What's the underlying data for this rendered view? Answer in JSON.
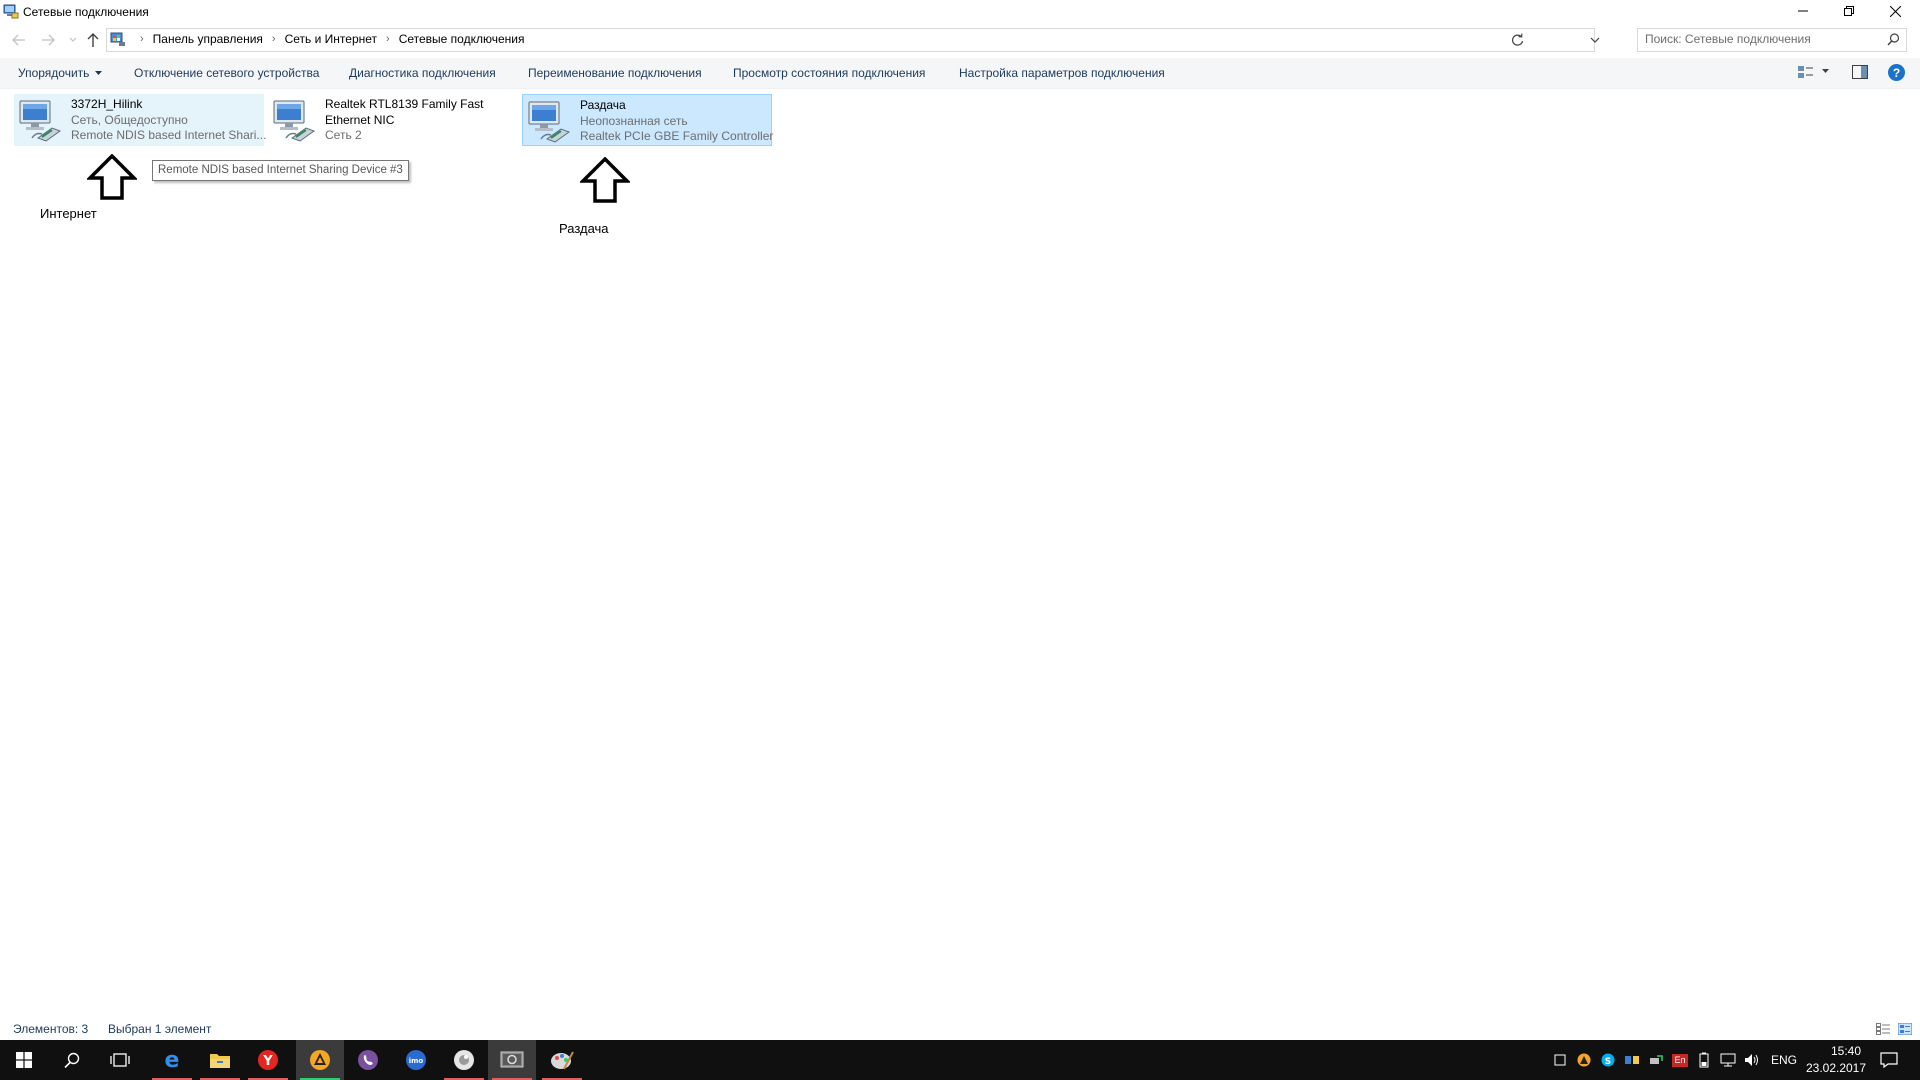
{
  "window": {
    "title": "Сетевые подключения"
  },
  "address": {
    "breadcrumbs": [
      "Панель управления",
      "Сеть и Интернет",
      "Сетевые подключения"
    ],
    "search_placeholder": "Поиск: Сетевые подключения"
  },
  "commands": {
    "organize": "Упорядочить",
    "items": [
      "Отключение сетевого устройства",
      "Диагностика подключения",
      "Переименование подключения",
      "Просмотр состояния подключения",
      "Настройка параметров подключения"
    ]
  },
  "connections": [
    {
      "name": "3372H_Hilink",
      "status": "Сеть, Общедоступно",
      "device": "Remote NDIS based Internet Shari..."
    },
    {
      "name": "Realtek RTL8139 Family Fast",
      "name2": "Ethernet NIC",
      "status": "Сеть  2"
    },
    {
      "name": "Раздача",
      "status": "Неопознанная сеть",
      "device": "Realtek PCIe GBE Family Controller"
    }
  ],
  "tooltip": "Remote NDIS based Internet Sharing Device #3",
  "annotations": [
    "Интернет",
    "Раздача"
  ],
  "status": {
    "count": "Элементов: 3",
    "selected": "Выбран 1 элемент"
  },
  "taskbar": {
    "apps": [
      "start-icon",
      "search-icon",
      "task-view-icon",
      "edge-icon",
      "file-explorer-icon",
      "yandex-browser-icon",
      "aimp-icon",
      "viber-icon",
      "imo-icon",
      "app-icon",
      "network-settings-icon",
      "paint-icon"
    ],
    "language_indicator": "En",
    "language": "ENG",
    "time": "15:40",
    "date": "23.02.2017"
  },
  "colors": {
    "selection": "#cce8ff",
    "hover": "#e5f3fb",
    "command_text": "#1e395b",
    "taskbar": "#101010"
  }
}
